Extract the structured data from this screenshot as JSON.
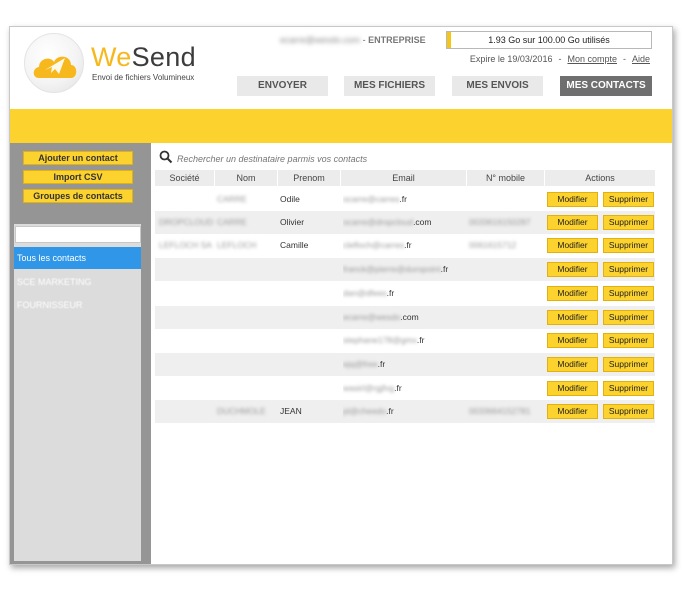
{
  "brand": {
    "name_part1": "We",
    "name_part2": "Send",
    "tagline": "Envoi de fichiers Volumineux"
  },
  "user": {
    "email": "ecarre@wesdo.com",
    "separator": " - ",
    "plan": "ENTREPRISE"
  },
  "quota": {
    "text": "1.93 Go sur 100.00 Go utilisés",
    "used_fraction": 0.0193
  },
  "meta": {
    "expiry": "Expire le 19/03/2016",
    "account_link": "Mon compte",
    "help_link": "Aide"
  },
  "nav": {
    "send": "ENVOYER",
    "files": "MES FICHIERS",
    "sends": "MES ENVOIS",
    "contacts": "MES CONTACTS"
  },
  "sidebar": {
    "add_contact": "Ajouter un contact",
    "import_csv": "Import CSV",
    "contact_groups": "Groupes de contacts",
    "group_input_value": "",
    "groups": [
      "Tous les contacts",
      "SCE MARKETING",
      "FOURNISSEUR"
    ]
  },
  "search": {
    "placeholder": "Rechercher un destinataire parmis vos contacts"
  },
  "table": {
    "headers": {
      "company": "Société",
      "name": "Nom",
      "firstname": "Prenom",
      "email": "Email",
      "mobile": "N° mobile",
      "actions": "Actions"
    },
    "modify_label": "Modifier",
    "delete_label": "Supprimer",
    "rows": [
      {
        "company": "",
        "name": "CARRE",
        "firstname": "Odile",
        "email_blur": "ocarre@carres",
        "email_tail": ".fr",
        "mobile": ""
      },
      {
        "company": "DROPCLOUD",
        "name": "CARRE",
        "firstname": "Olivier",
        "email_blur": "ocarre@dropcloud",
        "email_tail": ".com",
        "mobile": "0033616150287"
      },
      {
        "company": "LEFLOCH SA",
        "name": "LEFLOCH",
        "firstname": "Camille",
        "email_blur": "clefloch@carres",
        "email_tail": ".fr",
        "mobile": "0061615712"
      },
      {
        "company": "",
        "name": "",
        "firstname": "",
        "email_blur": "franck@pierre@duropoint",
        "email_tail": ".fr",
        "mobile": ""
      },
      {
        "company": "",
        "name": "",
        "firstname": "",
        "email_blur": "dan@dfees",
        "email_tail": ".fr",
        "mobile": ""
      },
      {
        "company": "",
        "name": "",
        "firstname": "",
        "email_blur": "ecarre@wesdo",
        "email_tail": ".com",
        "mobile": ""
      },
      {
        "company": "",
        "name": "",
        "firstname": "",
        "email_blur": "stephane178@gmx",
        "email_tail": ".fr",
        "mobile": ""
      },
      {
        "company": "",
        "name": "",
        "firstname": "",
        "email_blur": "ejq@free",
        "email_tail": ".fr",
        "mobile": ""
      },
      {
        "company": "",
        "name": "",
        "firstname": "",
        "email_blur": "wasirl@rgjfvg",
        "email_tail": ".fr",
        "mobile": ""
      },
      {
        "company": "",
        "name": "DUCHMOLE",
        "firstname": "JEAN",
        "email_blur": "jd@cheedo",
        "email_tail": ".fr",
        "mobile": "0033664152781"
      }
    ]
  },
  "colors": {
    "accent_yellow": "#fcd22f",
    "active_blue": "#2f96e8",
    "nav_active": "#6f6f6f",
    "sidebar_gray": "#959595"
  }
}
